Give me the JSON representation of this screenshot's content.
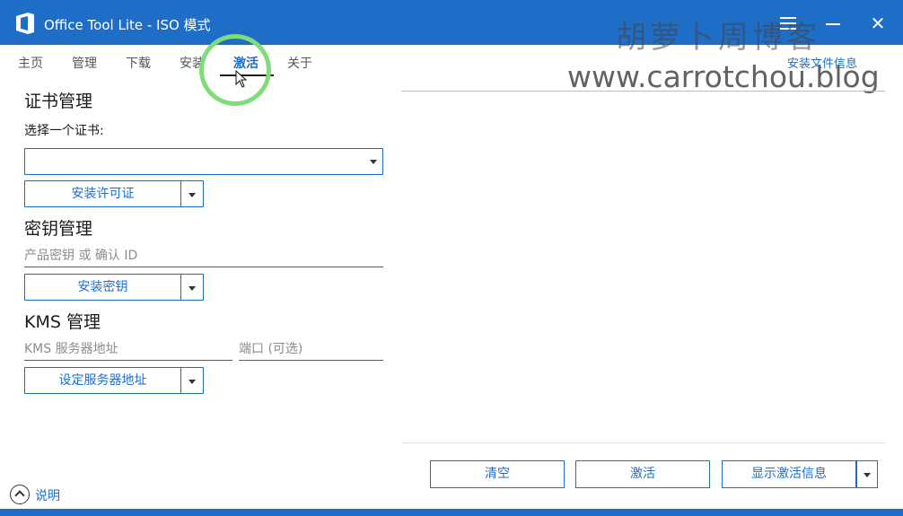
{
  "window": {
    "title": "Office Tool Lite - ISO 模式"
  },
  "watermark": {
    "line1": "胡萝卜周博客",
    "line2": "www.carrotchou.blog"
  },
  "tabs": [
    {
      "label": "主页"
    },
    {
      "label": "管理"
    },
    {
      "label": "下载"
    },
    {
      "label": "安装"
    },
    {
      "label": "激活"
    },
    {
      "label": "关于"
    }
  ],
  "active_tab": "激活",
  "file_info_link": "安装文件信息",
  "certificate": {
    "title": "证书管理",
    "select_label": "选择一个证书:",
    "selected_value": "",
    "install_button": "安装许可证"
  },
  "key": {
    "title": "密钥管理",
    "placeholder": "产品密钥 或 确认 ID",
    "install_button": "安装密钥"
  },
  "kms": {
    "title": "KMS 管理",
    "server_placeholder": "KMS 服务器地址",
    "port_placeholder": "端口 (可选)",
    "set_button": "设定服务器地址"
  },
  "actions": {
    "clear": "清空",
    "activate": "激活",
    "show_info": "显示激活信息"
  },
  "help": {
    "label": "说明"
  },
  "colors": {
    "accent": "#1e6ec8",
    "highlight": "#7fdc7a"
  },
  "icons": {
    "app": "office-icon",
    "menu": "hamburger-icon",
    "minimize": "minimize-icon",
    "close": "close-icon",
    "dropdown": "chevron-down-icon",
    "help": "chevron-up-circle-icon",
    "cursor": "mouse-cursor-icon"
  }
}
